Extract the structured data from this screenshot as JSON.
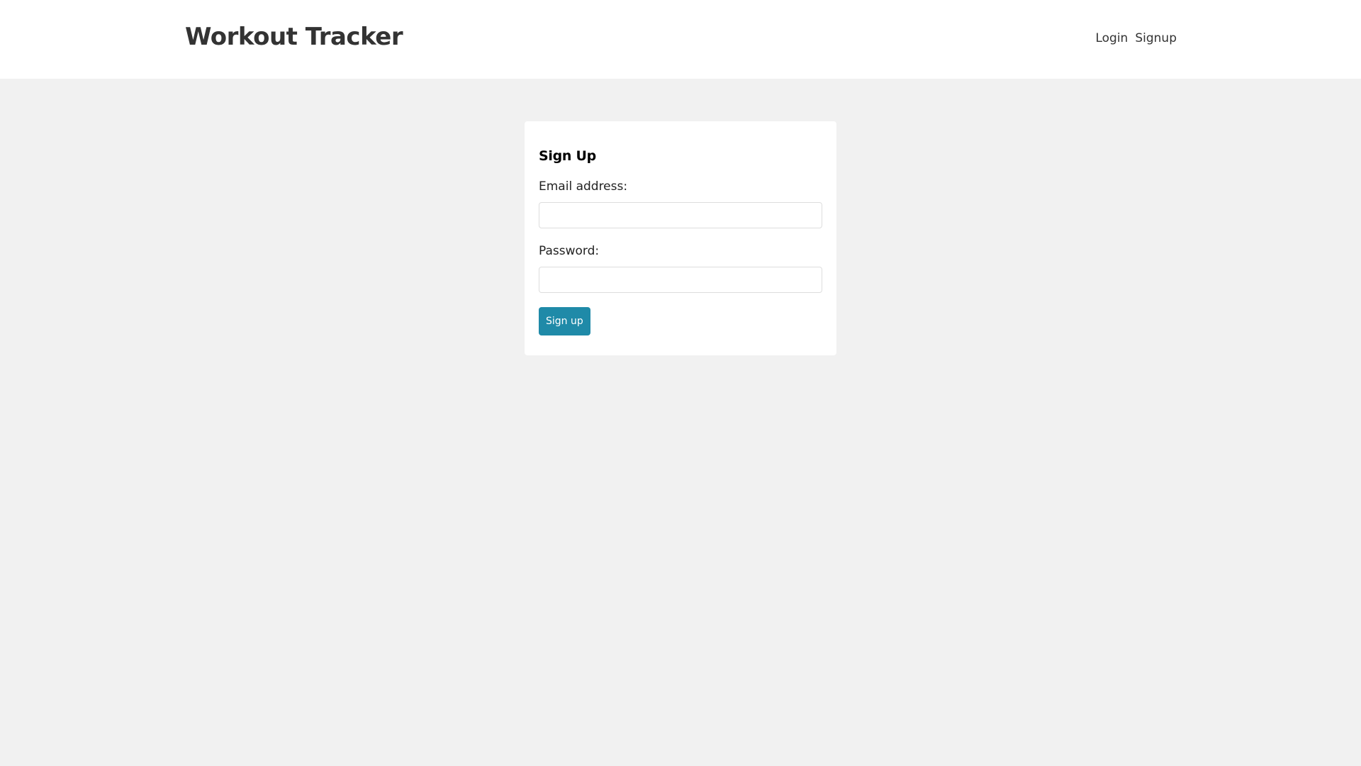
{
  "header": {
    "brand": "Workout Tracker",
    "nav": {
      "login": "Login",
      "signup": "Signup"
    }
  },
  "signup_form": {
    "title": "Sign Up",
    "email_label": "Email address:",
    "email_value": "",
    "password_label": "Password:",
    "password_value": "",
    "submit_label": "Sign up"
  },
  "colors": {
    "page_background": "#f1f1f1",
    "header_background": "#ffffff",
    "primary_button": "#1f8aa8",
    "text": "#333333"
  }
}
